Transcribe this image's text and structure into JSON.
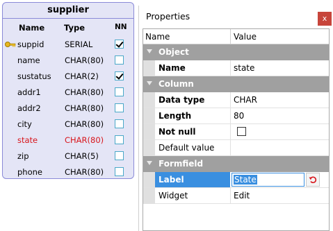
{
  "entity": {
    "title": "supplier",
    "headers": {
      "name": "Name",
      "type": "Type",
      "nn": "NN"
    },
    "fields": [
      {
        "name": "suppid",
        "type": "SERIAL",
        "nn": true,
        "key": true,
        "highlight": false
      },
      {
        "name": "name",
        "type": "CHAR(80)",
        "nn": false,
        "key": false,
        "highlight": false
      },
      {
        "name": "sustatus",
        "type": "CHAR(2)",
        "nn": true,
        "key": false,
        "highlight": false
      },
      {
        "name": "addr1",
        "type": "CHAR(80)",
        "nn": false,
        "key": false,
        "highlight": false
      },
      {
        "name": "addr2",
        "type": "CHAR(80)",
        "nn": false,
        "key": false,
        "highlight": false
      },
      {
        "name": "city",
        "type": "CHAR(80)",
        "nn": false,
        "key": false,
        "highlight": false
      },
      {
        "name": "state",
        "type": "CHAR(80)",
        "nn": false,
        "key": false,
        "highlight": true
      },
      {
        "name": "zip",
        "type": "CHAR(5)",
        "nn": false,
        "key": false,
        "highlight": false
      },
      {
        "name": "phone",
        "type": "CHAR(80)",
        "nn": false,
        "key": false,
        "highlight": false
      }
    ],
    "key_icon": "key-icon",
    "highlight_color": "#d8151b"
  },
  "properties": {
    "title": "Properties",
    "close_label": "x",
    "headers": {
      "name": "Name",
      "value": "Value"
    },
    "categories": {
      "object": "Object",
      "column": "Column",
      "formfield": "Formfield"
    },
    "rows": {
      "name": {
        "label": "Name",
        "value": "state"
      },
      "data_type": {
        "label": "Data type",
        "value": "CHAR"
      },
      "length": {
        "label": "Length",
        "value": "80"
      },
      "not_null": {
        "label": "Not null",
        "checked": false
      },
      "default_value": {
        "label": "Default value",
        "value": ""
      },
      "label": {
        "label": "Label",
        "value": "State"
      },
      "widget": {
        "label": "Widget",
        "value": "Edit"
      }
    },
    "reset_icon": "undo-icon",
    "accent_color": "#3a8fe0"
  }
}
